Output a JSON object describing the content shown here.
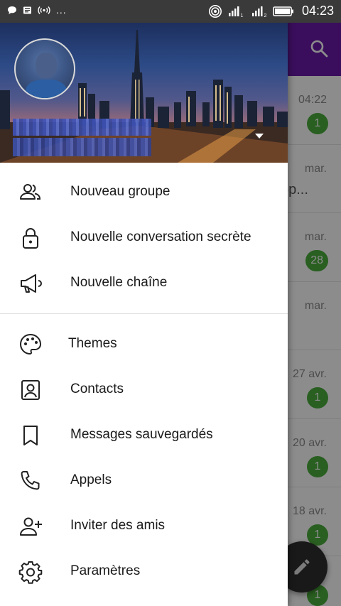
{
  "statusbar": {
    "time": "04:23",
    "dots": "...",
    "sim1_label": "1",
    "sim2_label": "2"
  },
  "drawer": {
    "menu_group1": [
      {
        "label": "Nouveau groupe",
        "icon": "group-icon"
      },
      {
        "label": "Nouvelle conversation secrète",
        "icon": "lock-icon"
      },
      {
        "label": "Nouvelle chaîne",
        "icon": "megaphone-icon"
      }
    ],
    "menu_group2": [
      {
        "label": "Themes",
        "icon": "palette-icon"
      },
      {
        "label": "Contacts",
        "icon": "contact-icon"
      },
      {
        "label": "Messages sauvegardés",
        "icon": "bookmark-icon"
      },
      {
        "label": "Appels",
        "icon": "phone-icon"
      },
      {
        "label": "Inviter des amis",
        "icon": "add-person-icon"
      },
      {
        "label": "Paramètres",
        "icon": "gear-icon"
      }
    ]
  },
  "chats": [
    {
      "time": "04:22",
      "unread": "1",
      "preview": ""
    },
    {
      "time": "mar.",
      "unread": "",
      "preview": "op..."
    },
    {
      "time": "mar.",
      "unread": "28",
      "preview": ""
    },
    {
      "time": "mar.",
      "unread": "",
      "preview": ""
    },
    {
      "time": "27 avr.",
      "unread": "1",
      "preview": ""
    },
    {
      "time": "20 avr.",
      "unread": "1",
      "preview": ""
    },
    {
      "time": "18 avr.",
      "unread": "1",
      "preview": ""
    },
    {
      "time": "",
      "unread": "1",
      "preview": ""
    }
  ],
  "colors": {
    "topbar": "#6a1aa8",
    "unread_badge": "#4cae3c",
    "fab": "#2e2e2e"
  }
}
